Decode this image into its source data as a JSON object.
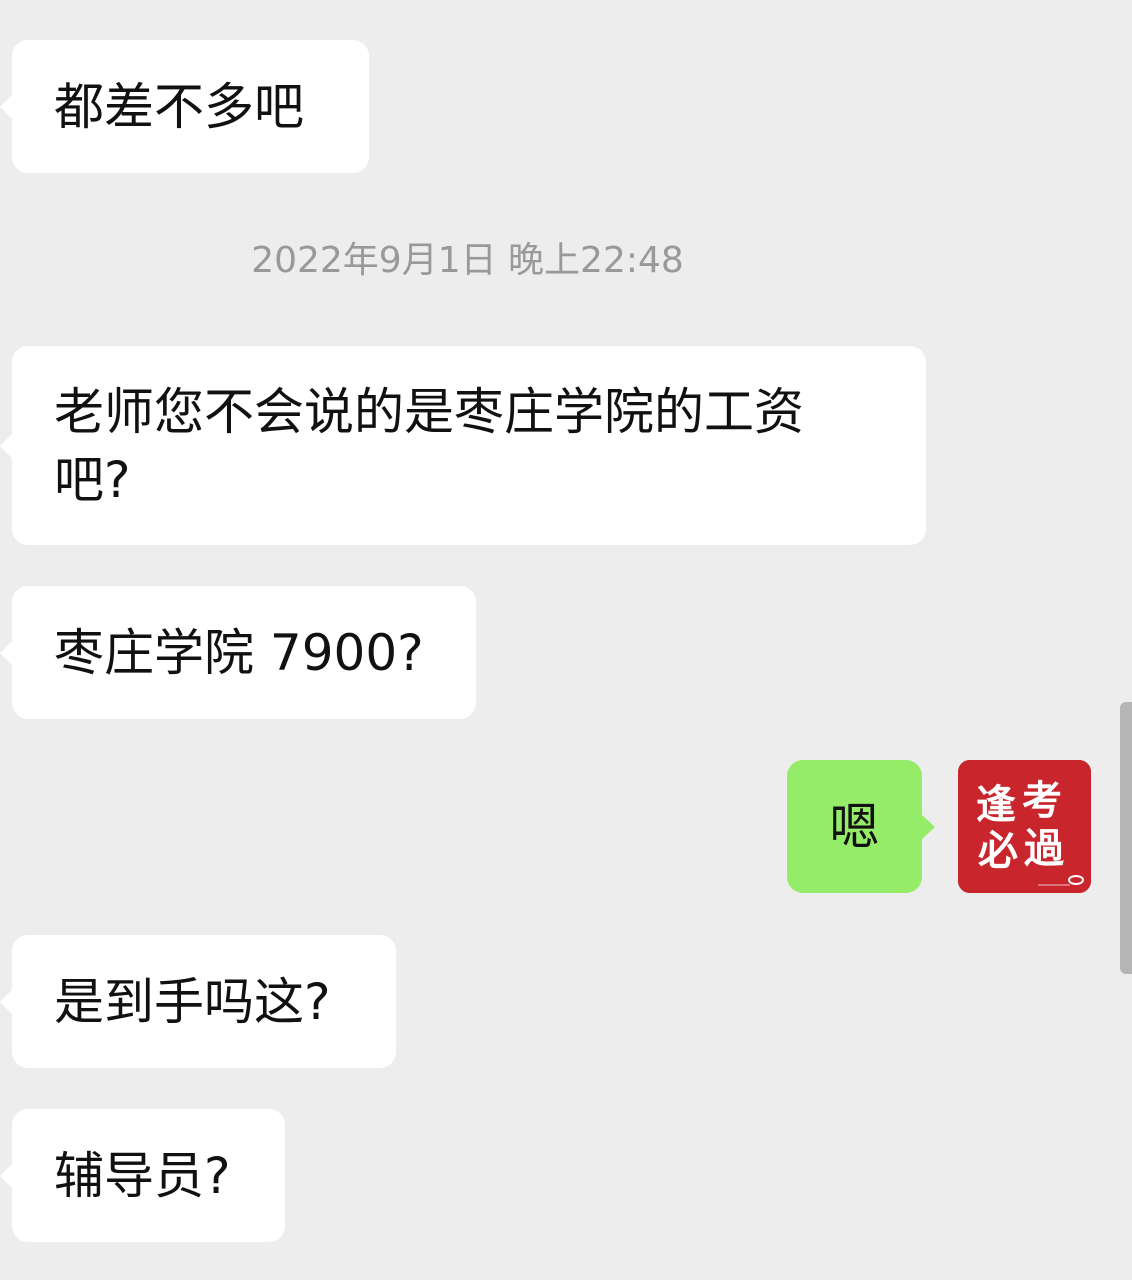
{
  "colors": {
    "background": "#ededed",
    "received_bubble": "#ffffff",
    "sent_bubble": "#95ec69",
    "timestamp_text": "#999999",
    "avatar_background": "#c9252c"
  },
  "messages": [
    {
      "side": "received",
      "text": "都差不多吧"
    },
    {
      "type": "timestamp",
      "text": "2022年9月1日 晚上22:48"
    },
    {
      "side": "received",
      "text": "老师您不会说的是枣庄学院的工资\n吧?"
    },
    {
      "side": "received",
      "text": "枣庄学院 7900?"
    },
    {
      "side": "sent",
      "text": "嗯"
    },
    {
      "side": "received",
      "text": "是到手吗这?"
    },
    {
      "side": "received",
      "text": "辅导员?"
    }
  ],
  "avatar": {
    "icon": "red-calligraphy-avatar-icon",
    "text": "逢考必過"
  }
}
